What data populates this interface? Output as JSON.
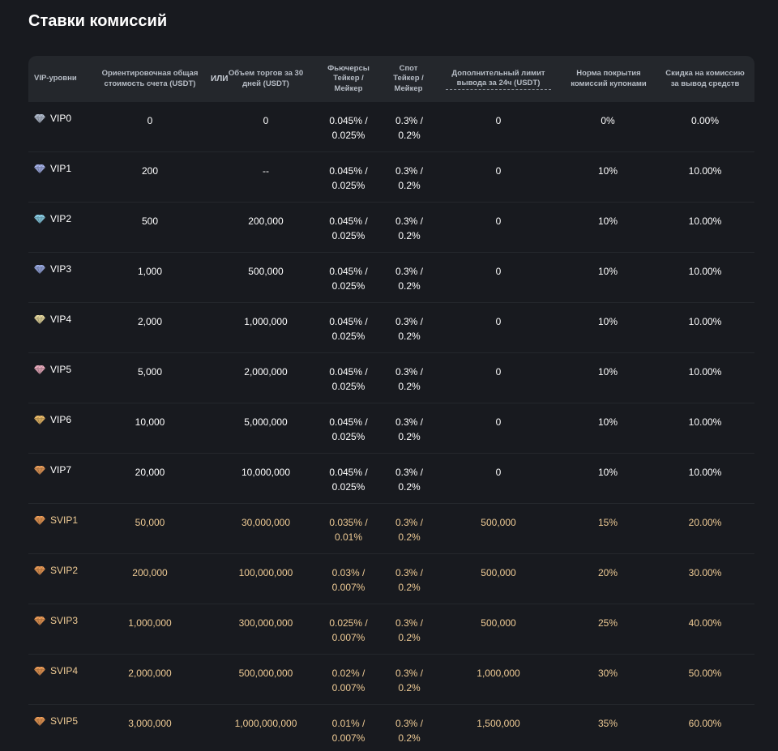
{
  "page": {
    "title": "Ставки комиссий"
  },
  "table": {
    "headers": {
      "vip_level": "VIP-уровни",
      "balance": "Ориентировочная общая стоимость счета (USDT)",
      "or": "ИЛИ",
      "volume": "Объем торгов за 30 дней (USDT)",
      "futures": "Фьючерсы Тейкер / Мейкер",
      "spot": "Спот Тейкер / Мейкер",
      "withdraw_limit": "Дополнительный лимит вывода за 24ч (USDT)",
      "coupon_rate": "Норма покрытия комиссий купонами",
      "withdraw_discount": "Скидка на комиссию за вывод средств"
    },
    "rows": [
      {
        "level": "VIP0",
        "gem_color": "#b9c4d6",
        "balance": "0",
        "volume": "0",
        "futures_1": "0.045% /",
        "futures_2": "0.025%",
        "spot_1": "0.3% /",
        "spot_2": "0.2%",
        "withdraw_limit": "0",
        "coupon_rate": "0%",
        "withdraw_discount": "0.00%"
      },
      {
        "level": "VIP1",
        "gem_color": "#aab7f0",
        "balance": "200",
        "volume": "--",
        "futures_1": "0.045% /",
        "futures_2": "0.025%",
        "spot_1": "0.3% /",
        "spot_2": "0.2%",
        "withdraw_limit": "0",
        "coupon_rate": "10%",
        "withdraw_discount": "10.00%"
      },
      {
        "level": "VIP2",
        "gem_color": "#8fd6ee",
        "balance": "500",
        "volume": "200,000",
        "futures_1": "0.045% /",
        "futures_2": "0.025%",
        "spot_1": "0.3% /",
        "spot_2": "0.2%",
        "withdraw_limit": "0",
        "coupon_rate": "10%",
        "withdraw_discount": "10.00%"
      },
      {
        "level": "VIP3",
        "gem_color": "#9fb0ea",
        "balance": "1,000",
        "volume": "500,000",
        "futures_1": "0.045% /",
        "futures_2": "0.025%",
        "spot_1": "0.3% /",
        "spot_2": "0.2%",
        "withdraw_limit": "0",
        "coupon_rate": "10%",
        "withdraw_discount": "10.00%"
      },
      {
        "level": "VIP4",
        "gem_color": "#f0e2a6",
        "balance": "2,000",
        "volume": "1,000,000",
        "futures_1": "0.045% /",
        "futures_2": "0.025%",
        "spot_1": "0.3% /",
        "spot_2": "0.2%",
        "withdraw_limit": "0",
        "coupon_rate": "10%",
        "withdraw_discount": "10.00%"
      },
      {
        "level": "VIP5",
        "gem_color": "#f3b3c6",
        "balance": "5,000",
        "volume": "2,000,000",
        "futures_1": "0.045% /",
        "futures_2": "0.025%",
        "spot_1": "0.3% /",
        "spot_2": "0.2%",
        "withdraw_limit": "0",
        "coupon_rate": "10%",
        "withdraw_discount": "10.00%"
      },
      {
        "level": "VIP6",
        "gem_color": "#f4c36e",
        "balance": "10,000",
        "volume": "5,000,000",
        "futures_1": "0.045% /",
        "futures_2": "0.025%",
        "spot_1": "0.3% /",
        "spot_2": "0.2%",
        "withdraw_limit": "0",
        "coupon_rate": "10%",
        "withdraw_discount": "10.00%"
      },
      {
        "level": "VIP7",
        "gem_color": "#f0a25e",
        "balance": "20,000",
        "volume": "10,000,000",
        "futures_1": "0.045% /",
        "futures_2": "0.025%",
        "spot_1": "0.3% /",
        "spot_2": "0.2%",
        "withdraw_limit": "0",
        "coupon_rate": "10%",
        "withdraw_discount": "10.00%"
      },
      {
        "level": "SVIP1",
        "gem_color": "#f2a05a",
        "balance": "50,000",
        "volume": "30,000,000",
        "futures_1": "0.035% /",
        "futures_2": "0.01%",
        "spot_1": "0.3% /",
        "spot_2": "0.2%",
        "withdraw_limit": "500,000",
        "coupon_rate": "15%",
        "withdraw_discount": "20.00%"
      },
      {
        "level": "SVIP2",
        "gem_color": "#f2a05a",
        "balance": "200,000",
        "volume": "100,000,000",
        "futures_1": "0.03% /",
        "futures_2": "0.007%",
        "spot_1": "0.3% /",
        "spot_2": "0.2%",
        "withdraw_limit": "500,000",
        "coupon_rate": "20%",
        "withdraw_discount": "30.00%"
      },
      {
        "level": "SVIP3",
        "gem_color": "#f2a05a",
        "balance": "1,000,000",
        "volume": "300,000,000",
        "futures_1": "0.025% /",
        "futures_2": "0.007%",
        "spot_1": "0.3% /",
        "spot_2": "0.2%",
        "withdraw_limit": "500,000",
        "coupon_rate": "25%",
        "withdraw_discount": "40.00%"
      },
      {
        "level": "SVIP4",
        "gem_color": "#f2a05a",
        "balance": "2,000,000",
        "volume": "500,000,000",
        "futures_1": "0.02% /",
        "futures_2": "0.007%",
        "spot_1": "0.3% /",
        "spot_2": "0.2%",
        "withdraw_limit": "1,000,000",
        "coupon_rate": "30%",
        "withdraw_discount": "50.00%"
      },
      {
        "level": "SVIP5",
        "gem_color": "#f2a05a",
        "balance": "3,000,000",
        "volume": "1,000,000,000",
        "futures_1": "0.01% /",
        "futures_2": "0.007%",
        "spot_1": "0.3% /",
        "spot_2": "0.2%",
        "withdraw_limit": "1,500,000",
        "coupon_rate": "35%",
        "withdraw_discount": "60.00%"
      }
    ]
  }
}
